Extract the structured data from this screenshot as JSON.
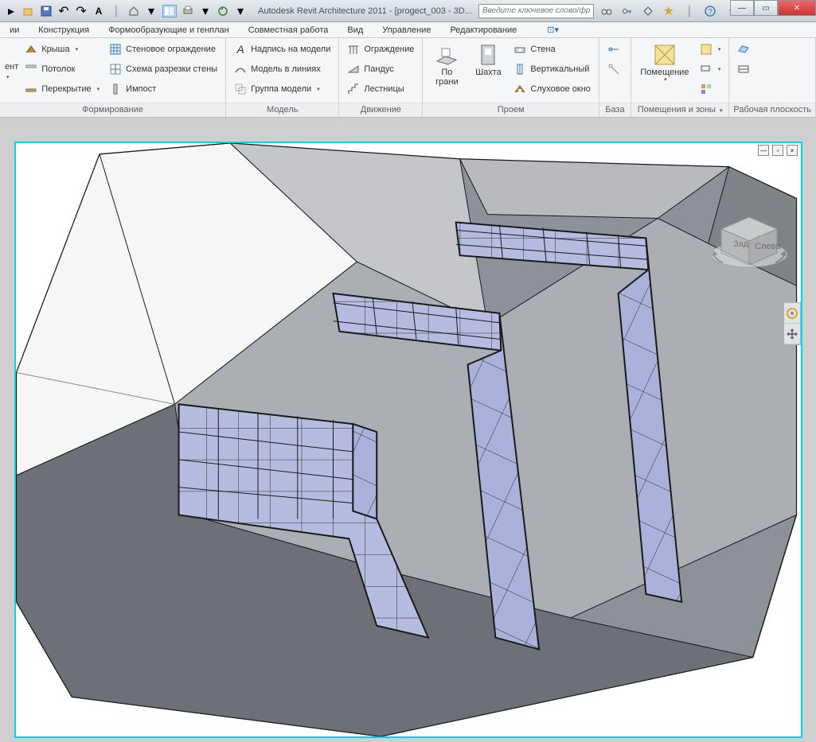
{
  "titlebar": {
    "app_title": "Autodesk Revit Architecture 2011 - [progect_003 - 3D...",
    "search_placeholder": "Введите ключевое слово/фразу"
  },
  "menubar": {
    "items": [
      "ии",
      "Конструкция",
      "Формообразующие и генплан",
      "Совместная работа",
      "Вид",
      "Управление",
      "Редактирование"
    ]
  },
  "ribbon": {
    "panels": [
      {
        "title": "Формирование",
        "left_label": "ент",
        "col1": [
          {
            "label": "Крыша",
            "has_drop": true
          },
          {
            "label": "Потолок",
            "has_drop": false
          },
          {
            "label": "Перекрытие",
            "has_drop": true
          }
        ],
        "col2": [
          {
            "label": "Стеновое ограждение"
          },
          {
            "label": "Схема разрезки стены"
          },
          {
            "label": "Импост"
          }
        ]
      },
      {
        "title": "Модель",
        "col1": [
          {
            "label": "Надпись на модели"
          },
          {
            "label": "Модель в линиях"
          },
          {
            "label": "Группа модели",
            "has_drop": true
          }
        ]
      },
      {
        "title": "Движение",
        "col1": [
          {
            "label": "Ограждение"
          },
          {
            "label": "Пандус"
          },
          {
            "label": "Лестницы"
          }
        ]
      },
      {
        "title": "Проем",
        "big1": {
          "line1": "По",
          "line2": "грани"
        },
        "big2": {
          "line1": "Шахта",
          "line2": ""
        },
        "col1": [
          {
            "label": "Стена"
          },
          {
            "label": "Вертикальный"
          },
          {
            "label": "Слуховое окно"
          }
        ]
      },
      {
        "title": "База"
      },
      {
        "title": "Помещения и зоны",
        "big1": {
          "line1": "Помещение",
          "line2": ""
        },
        "has_drop": true
      },
      {
        "title": "Рабочая плоскость"
      }
    ]
  },
  "viewcube": {
    "face1": "Зад",
    "face2": "Слева"
  }
}
